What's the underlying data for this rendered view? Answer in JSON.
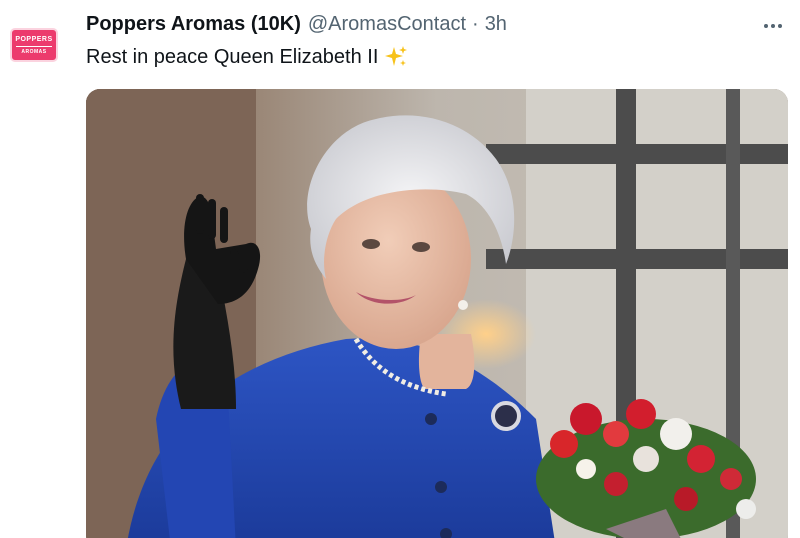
{
  "account": {
    "display_name": "Poppers Aromas (10K)",
    "handle": "@AromasContact",
    "separator": "·",
    "time": "3h",
    "avatar_text_top": "POPPERS",
    "avatar_text_bottom": "AROMAS"
  },
  "tweet": {
    "text": "Rest in peace Queen Elizabeth II",
    "emoji_icon": "sparkles-icon"
  },
  "colors": {
    "brand_pink": "#ec3b6d",
    "secondary_text": "#536471",
    "primary_text": "#0f1419"
  }
}
